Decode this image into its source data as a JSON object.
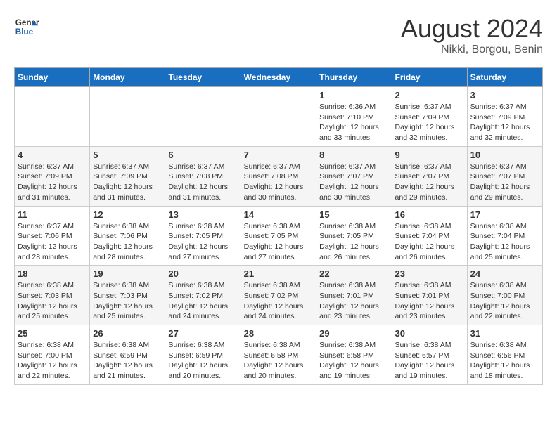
{
  "header": {
    "logo_line1": "General",
    "logo_line2": "Blue",
    "month": "August 2024",
    "location": "Nikki, Borgou, Benin"
  },
  "days_of_week": [
    "Sunday",
    "Monday",
    "Tuesday",
    "Wednesday",
    "Thursday",
    "Friday",
    "Saturday"
  ],
  "weeks": [
    [
      {
        "day": "",
        "info": ""
      },
      {
        "day": "",
        "info": ""
      },
      {
        "day": "",
        "info": ""
      },
      {
        "day": "",
        "info": ""
      },
      {
        "day": "1",
        "info": "Sunrise: 6:36 AM\nSunset: 7:10 PM\nDaylight: 12 hours\nand 33 minutes."
      },
      {
        "day": "2",
        "info": "Sunrise: 6:37 AM\nSunset: 7:09 PM\nDaylight: 12 hours\nand 32 minutes."
      },
      {
        "day": "3",
        "info": "Sunrise: 6:37 AM\nSunset: 7:09 PM\nDaylight: 12 hours\nand 32 minutes."
      }
    ],
    [
      {
        "day": "4",
        "info": "Sunrise: 6:37 AM\nSunset: 7:09 PM\nDaylight: 12 hours\nand 31 minutes."
      },
      {
        "day": "5",
        "info": "Sunrise: 6:37 AM\nSunset: 7:09 PM\nDaylight: 12 hours\nand 31 minutes."
      },
      {
        "day": "6",
        "info": "Sunrise: 6:37 AM\nSunset: 7:08 PM\nDaylight: 12 hours\nand 31 minutes."
      },
      {
        "day": "7",
        "info": "Sunrise: 6:37 AM\nSunset: 7:08 PM\nDaylight: 12 hours\nand 30 minutes."
      },
      {
        "day": "8",
        "info": "Sunrise: 6:37 AM\nSunset: 7:07 PM\nDaylight: 12 hours\nand 30 minutes."
      },
      {
        "day": "9",
        "info": "Sunrise: 6:37 AM\nSunset: 7:07 PM\nDaylight: 12 hours\nand 29 minutes."
      },
      {
        "day": "10",
        "info": "Sunrise: 6:37 AM\nSunset: 7:07 PM\nDaylight: 12 hours\nand 29 minutes."
      }
    ],
    [
      {
        "day": "11",
        "info": "Sunrise: 6:37 AM\nSunset: 7:06 PM\nDaylight: 12 hours\nand 28 minutes."
      },
      {
        "day": "12",
        "info": "Sunrise: 6:38 AM\nSunset: 7:06 PM\nDaylight: 12 hours\nand 28 minutes."
      },
      {
        "day": "13",
        "info": "Sunrise: 6:38 AM\nSunset: 7:05 PM\nDaylight: 12 hours\nand 27 minutes."
      },
      {
        "day": "14",
        "info": "Sunrise: 6:38 AM\nSunset: 7:05 PM\nDaylight: 12 hours\nand 27 minutes."
      },
      {
        "day": "15",
        "info": "Sunrise: 6:38 AM\nSunset: 7:05 PM\nDaylight: 12 hours\nand 26 minutes."
      },
      {
        "day": "16",
        "info": "Sunrise: 6:38 AM\nSunset: 7:04 PM\nDaylight: 12 hours\nand 26 minutes."
      },
      {
        "day": "17",
        "info": "Sunrise: 6:38 AM\nSunset: 7:04 PM\nDaylight: 12 hours\nand 25 minutes."
      }
    ],
    [
      {
        "day": "18",
        "info": "Sunrise: 6:38 AM\nSunset: 7:03 PM\nDaylight: 12 hours\nand 25 minutes."
      },
      {
        "day": "19",
        "info": "Sunrise: 6:38 AM\nSunset: 7:03 PM\nDaylight: 12 hours\nand 25 minutes."
      },
      {
        "day": "20",
        "info": "Sunrise: 6:38 AM\nSunset: 7:02 PM\nDaylight: 12 hours\nand 24 minutes."
      },
      {
        "day": "21",
        "info": "Sunrise: 6:38 AM\nSunset: 7:02 PM\nDaylight: 12 hours\nand 24 minutes."
      },
      {
        "day": "22",
        "info": "Sunrise: 6:38 AM\nSunset: 7:01 PM\nDaylight: 12 hours\nand 23 minutes."
      },
      {
        "day": "23",
        "info": "Sunrise: 6:38 AM\nSunset: 7:01 PM\nDaylight: 12 hours\nand 23 minutes."
      },
      {
        "day": "24",
        "info": "Sunrise: 6:38 AM\nSunset: 7:00 PM\nDaylight: 12 hours\nand 22 minutes."
      }
    ],
    [
      {
        "day": "25",
        "info": "Sunrise: 6:38 AM\nSunset: 7:00 PM\nDaylight: 12 hours\nand 22 minutes."
      },
      {
        "day": "26",
        "info": "Sunrise: 6:38 AM\nSunset: 6:59 PM\nDaylight: 12 hours\nand 21 minutes."
      },
      {
        "day": "27",
        "info": "Sunrise: 6:38 AM\nSunset: 6:59 PM\nDaylight: 12 hours\nand 20 minutes."
      },
      {
        "day": "28",
        "info": "Sunrise: 6:38 AM\nSunset: 6:58 PM\nDaylight: 12 hours\nand 20 minutes."
      },
      {
        "day": "29",
        "info": "Sunrise: 6:38 AM\nSunset: 6:58 PM\nDaylight: 12 hours\nand 19 minutes."
      },
      {
        "day": "30",
        "info": "Sunrise: 6:38 AM\nSunset: 6:57 PM\nDaylight: 12 hours\nand 19 minutes."
      },
      {
        "day": "31",
        "info": "Sunrise: 6:38 AM\nSunset: 6:56 PM\nDaylight: 12 hours\nand 18 minutes."
      }
    ]
  ]
}
